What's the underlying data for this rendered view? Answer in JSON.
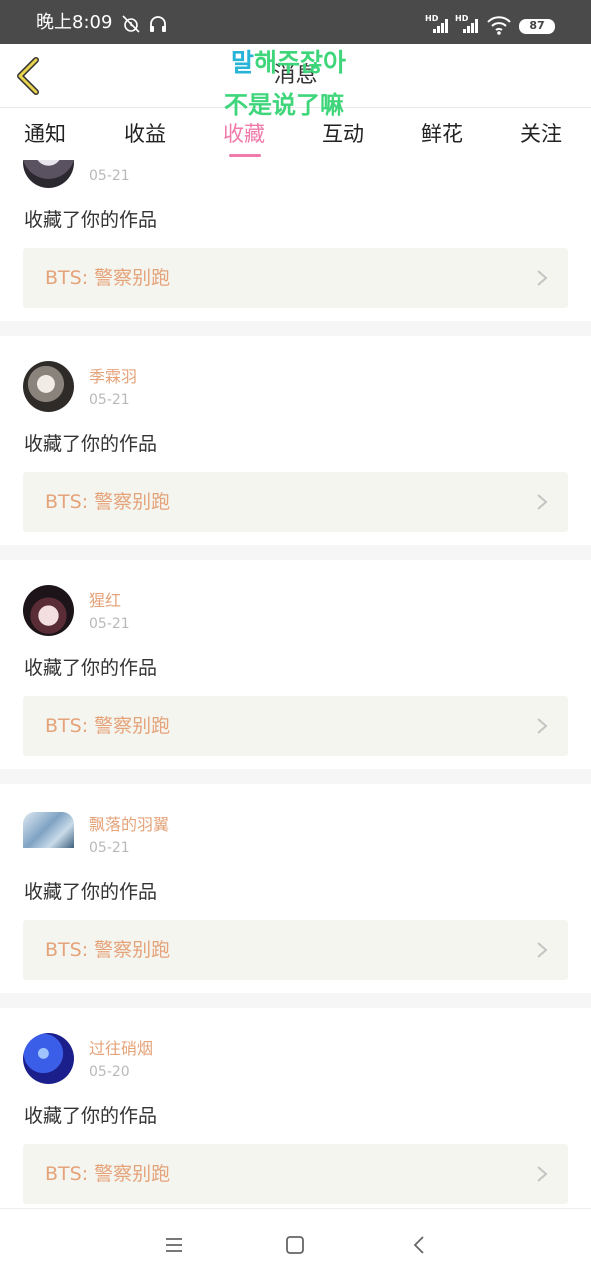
{
  "status_bar": {
    "time": "晚上8:09",
    "network_tag": "HD",
    "battery": "87"
  },
  "header": {
    "title": "消息",
    "overlay_korean": "말해주잖아",
    "overlay_korean_first": "말",
    "overlay_korean_rest": "해주잖아",
    "overlay_chinese": "不是说了嘛"
  },
  "tabs": [
    {
      "label": "通知",
      "active": false
    },
    {
      "label": "收益",
      "active": false
    },
    {
      "label": "收藏",
      "active": true
    },
    {
      "label": "互动",
      "active": false
    },
    {
      "label": "鲜花",
      "active": false
    },
    {
      "label": "关注",
      "active": false
    }
  ],
  "feed": [
    {
      "user": "",
      "date": "05-21",
      "action": "收藏了你的作品",
      "work_title": "BTS: 警察别跑"
    },
    {
      "user": "季霖羽",
      "date": "05-21",
      "action": "收藏了你的作品",
      "work_title": "BTS: 警察别跑"
    },
    {
      "user": "猩红",
      "date": "05-21",
      "action": "收藏了你的作品",
      "work_title": "BTS: 警察别跑"
    },
    {
      "user": "飘落的羽翼",
      "date": "05-21",
      "action": "收藏了你的作品",
      "work_title": "BTS: 警察别跑"
    },
    {
      "user": "过往硝烟",
      "date": "05-20",
      "action": "收藏了你的作品",
      "work_title": "BTS: 警察别跑"
    }
  ],
  "icons": {
    "back": "chevron-left-icon",
    "item_arrow": "chevron-right-icon",
    "nav_menu": "menu-icon",
    "nav_home": "square-home-icon",
    "nav_back": "back-icon"
  },
  "colors": {
    "accent": "#f07aa9",
    "username": "#e5a37a",
    "back_icon": "#e8d44d",
    "overlay_text": "#3fd67b"
  }
}
